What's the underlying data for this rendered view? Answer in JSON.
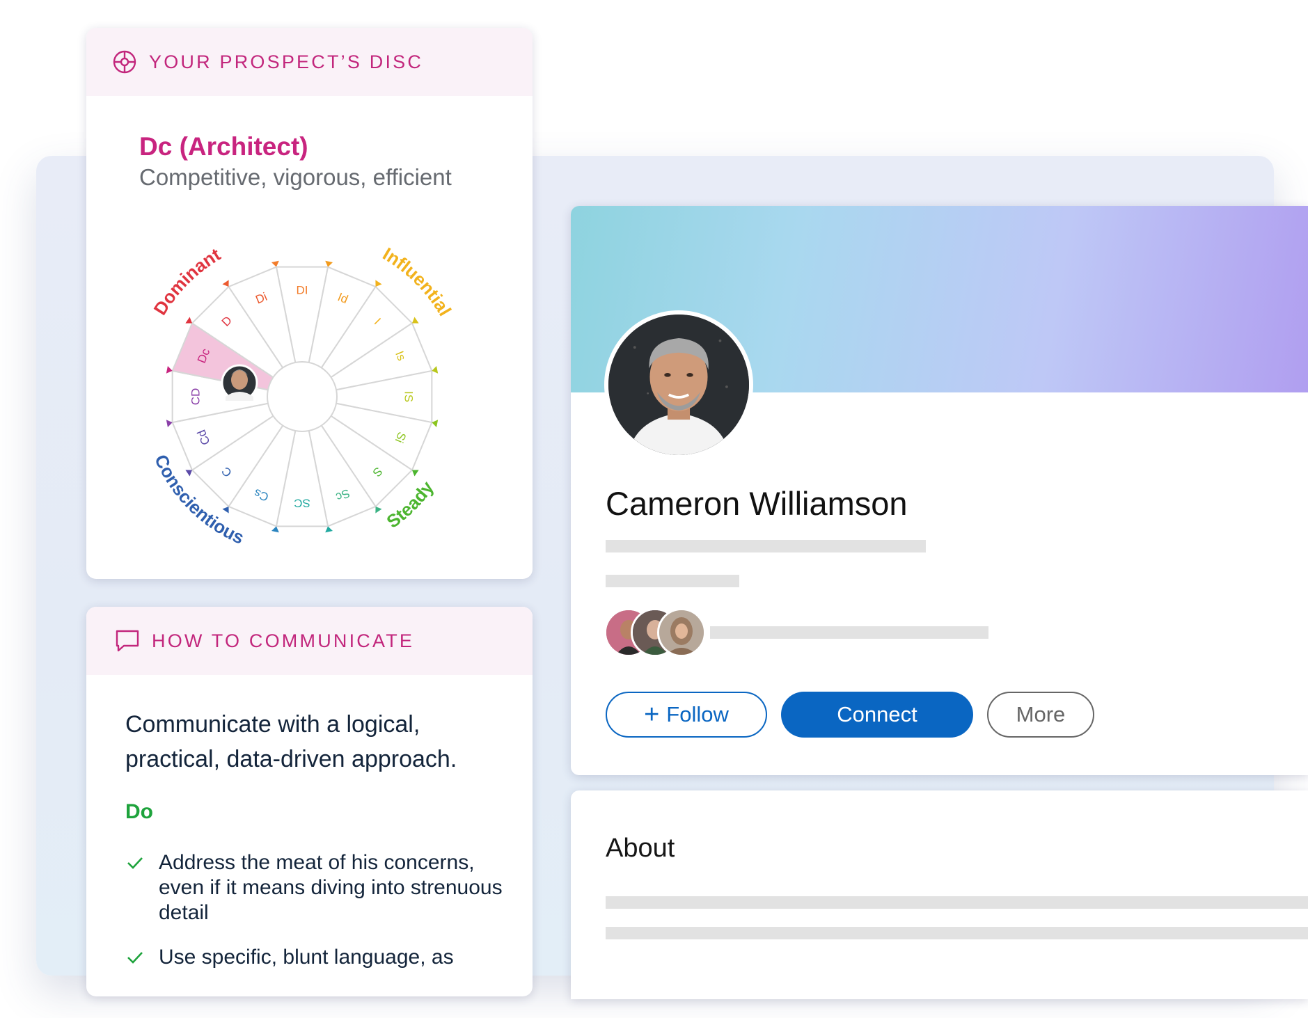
{
  "disc_card": {
    "header_icon": "crosshair-target-icon",
    "header_title": "YOUR PROSPECT’S DISC",
    "type_title": "Dc (Architect)",
    "type_description": "Competitive, vigorous, efficient",
    "wheel": {
      "selected_segment": "Dc",
      "segments": [
        "DI",
        "Id",
        "I",
        "Is",
        "IS",
        "Si",
        "S",
        "Sc",
        "SC",
        "Cs",
        "C",
        "Cd",
        "CD",
        "Dc",
        "D",
        "Di"
      ],
      "quadrants": [
        {
          "label": "Dominant",
          "color": "#e0343f"
        },
        {
          "label": "Influential",
          "color": "#f2b21c"
        },
        {
          "label": "Steady",
          "color": "#4cb52f"
        },
        {
          "label": "Conscientious",
          "color": "#2f5fae"
        }
      ],
      "highlight_color": "#f3c4dc"
    }
  },
  "comm_card": {
    "header_icon": "speech-bubble-icon",
    "header_title": "HOW TO COMMUNICATE",
    "lead": "Communicate with a logical, practical, data-driven approach.",
    "do_label": "Do",
    "do_items": [
      "Address the meat of his concerns, even if it means diving into strenuous detail",
      "Use specific, blunt language, as"
    ]
  },
  "profile": {
    "name": "Cameron Williamson",
    "buttons": {
      "follow": "Follow",
      "follow_icon": "plus-icon",
      "connect": "Connect",
      "more": "More"
    },
    "colors": {
      "brand_blue": "#0a66c2"
    }
  },
  "about": {
    "title": "About"
  }
}
